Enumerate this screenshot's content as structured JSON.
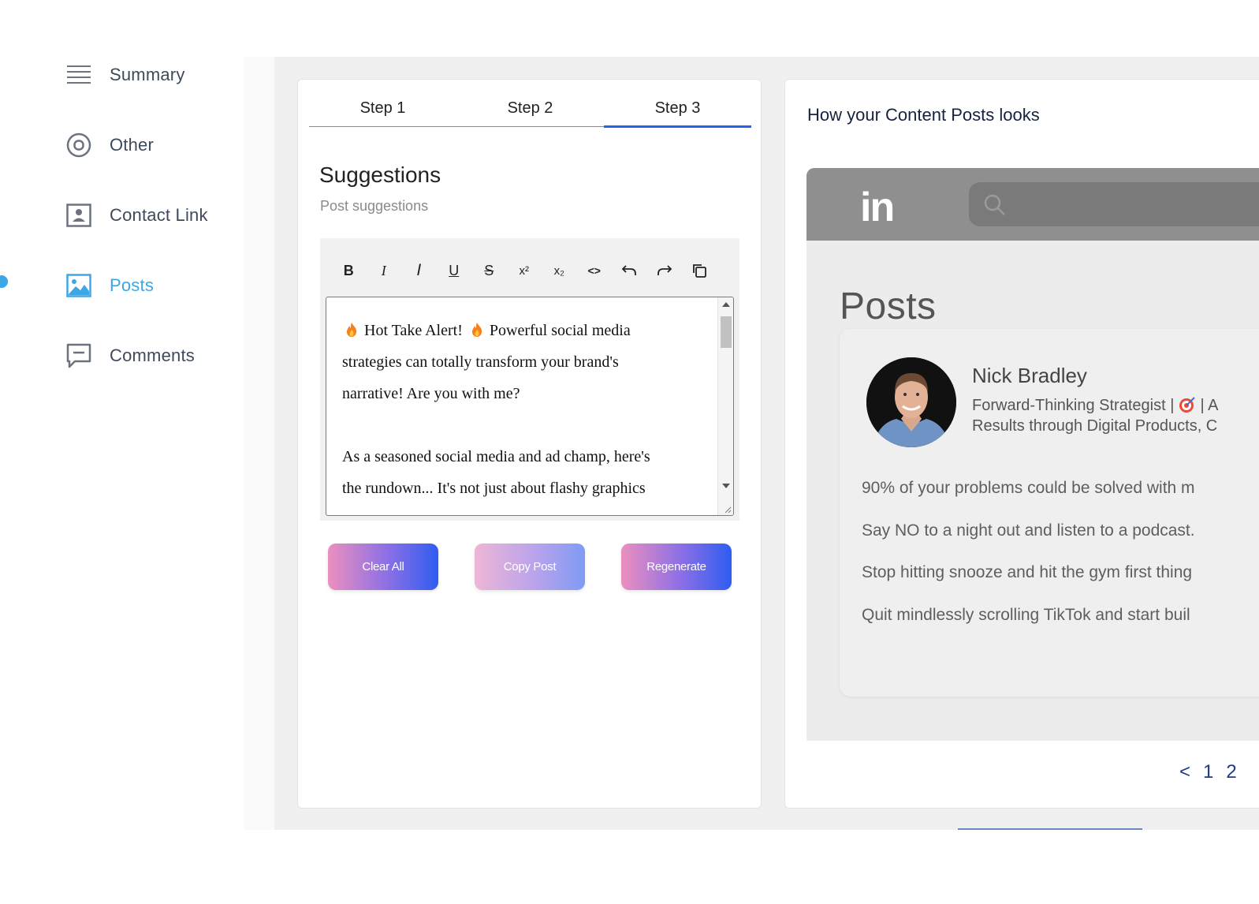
{
  "sidebar": {
    "items": [
      {
        "label": "Summary",
        "icon": "menu-lines-icon"
      },
      {
        "label": "Other",
        "icon": "target-circle-icon"
      },
      {
        "label": "Contact Link",
        "icon": "contact-card-icon"
      },
      {
        "label": "Posts",
        "icon": "image-icon",
        "active": true
      },
      {
        "label": "Comments",
        "icon": "comment-icon"
      }
    ]
  },
  "steps": {
    "tabs": [
      "Step 1",
      "Step 2",
      "Step 3"
    ],
    "active": "Step 3"
  },
  "suggestions": {
    "title": "Suggestions",
    "subtitle": "Post suggestions"
  },
  "editor": {
    "toolbar": [
      "B",
      "I",
      "I",
      "U",
      "S",
      "x²",
      "x₂",
      "<>",
      "undo",
      "redo",
      "copy"
    ],
    "line1_a": "Hot Take Alert!",
    "line1_b": "Powerful social media",
    "line2": "strategies can totally transform your brand's",
    "line3": "narrative! Are you with me?",
    "line5": "As a seasoned social media and ad champ, here's",
    "line6": "the rundown... It's not just about flashy graphics"
  },
  "actions": {
    "clear": "Clear All",
    "copy": "Copy Post",
    "regenerate": "Regenerate"
  },
  "preview": {
    "title": "How your Content Posts looks",
    "platform_logo": "in",
    "posts_heading": "Posts",
    "author": {
      "name": "Nick Bradley",
      "headline_1": "Forward-Thinking Strategist |",
      "headline_1_tail": "| A",
      "headline_2": "Results through Digital Products, C"
    },
    "lines": [
      "90% of your problems could be solved with m",
      "Say NO to a night out and listen to a podcast.",
      "Stop hitting snooze and hit the gym first thing",
      "Quit mindlessly scrolling TikTok and start buil"
    ],
    "pager": {
      "prev": "<",
      "p1": "1",
      "p2": "2"
    }
  },
  "colors": {
    "accent": "#3aa7e6",
    "tab_underline": "#2563eb",
    "gradient_start": "#ec8fbf",
    "gradient_end": "#2f5df1"
  }
}
